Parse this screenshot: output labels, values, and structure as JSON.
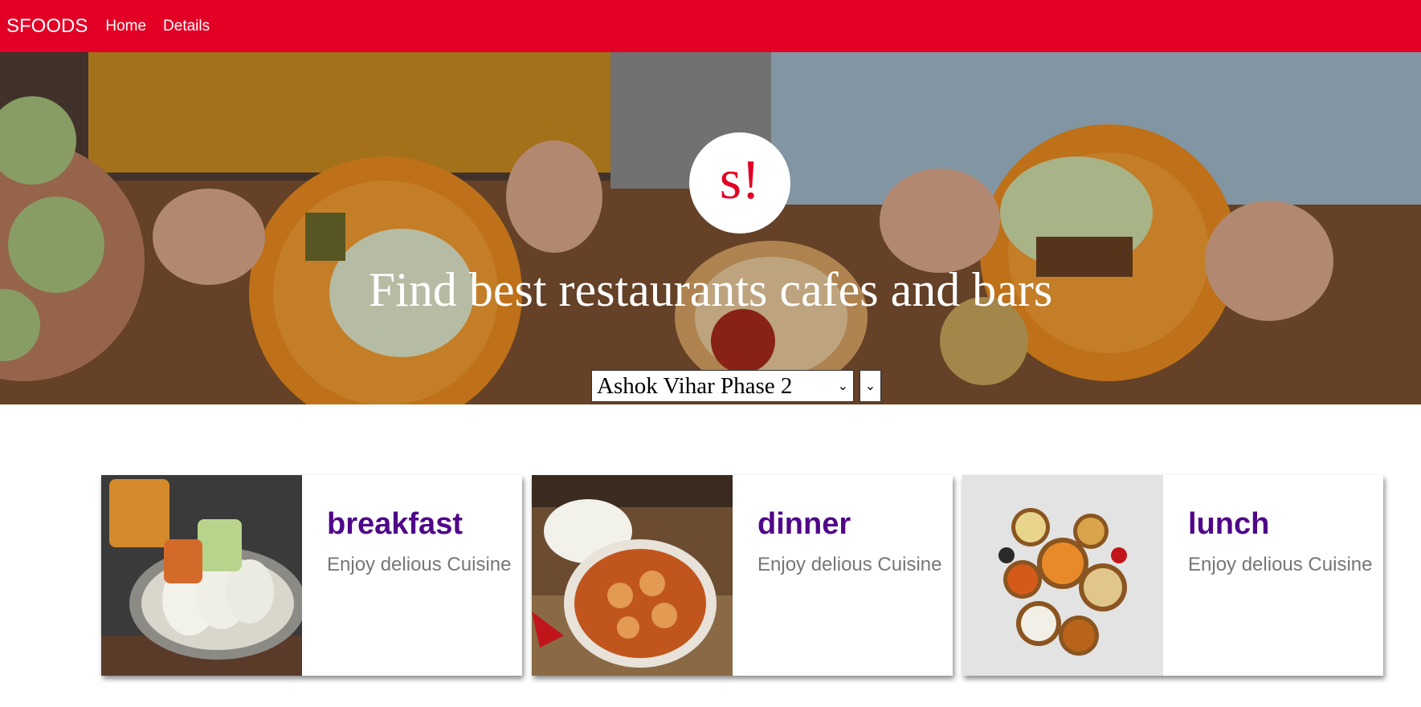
{
  "navbar": {
    "brand": "SFOODS",
    "links": [
      {
        "label": "Home"
      },
      {
        "label": "Details"
      }
    ]
  },
  "hero": {
    "logo": "s!",
    "title": "Find best restaurants cafes and bars",
    "location_select": {
      "selected": "Ashok Vihar Phase 2"
    }
  },
  "meal_types": [
    {
      "title": "breakfast",
      "subtitle": "Enjoy delious Cuisine"
    },
    {
      "title": "dinner",
      "subtitle": "Enjoy delious Cuisine"
    },
    {
      "title": "lunch",
      "subtitle": "Enjoy delious Cuisine"
    }
  ],
  "colors": {
    "navbar": "#e20025",
    "card_title": "#4f0688",
    "card_subtitle": "#767676"
  }
}
